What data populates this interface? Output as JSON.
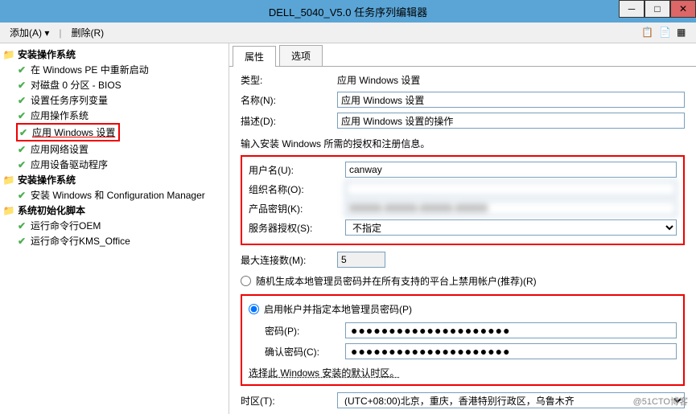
{
  "titlebar": {
    "title": "DELL_5040_V5.0 任务序列编辑器"
  },
  "toolbar": {
    "add": "添加(A) ▾",
    "remove": "删除(R)"
  },
  "tree": {
    "groups": [
      {
        "label": "安装操作系统",
        "items": [
          "在 Windows PE 中重新启动",
          "对磁盘 0 分区 - BIOS",
          "设置任务序列变量",
          "应用操作系统",
          "应用 Windows 设置",
          "应用网络设置",
          "应用设备驱动程序"
        ]
      },
      {
        "label": "安装操作系统",
        "items": [
          "安装 Windows 和 Configuration Manager"
        ]
      },
      {
        "label": "系统初始化脚本",
        "items": [
          "运行命令行OEM",
          "运行命令行KMS_Office"
        ]
      }
    ]
  },
  "tabs": {
    "props": "属性",
    "options": "选项"
  },
  "form": {
    "type_label": "类型:",
    "type_value": "应用 Windows 设置",
    "name_label": "名称(N):",
    "name_value": "应用 Windows 设置",
    "desc_label": "描述(D):",
    "desc_value": "应用 Windows 设置的操作",
    "section1": "输入安装 Windows 所需的授权和注册信息。",
    "user_label": "用户名(U):",
    "user_value": "canway",
    "org_label": "组织名称(O):",
    "org_value": "",
    "key_label": "产品密钥(K):",
    "key_value": "XXXXX-XXXXX-XXXXX-XXXXX",
    "lic_label": "服务器授权(S):",
    "lic_value": "不指定",
    "maxconn_label": "最大连接数(M):",
    "maxconn_value": "5",
    "radio1": "随机生成本地管理员密码并在所有支持的平台上禁用帐户(推荐)(R)",
    "radio2": "启用帐户并指定本地管理员密码(P)",
    "pwd_label": "密码(P):",
    "pwd_confirm_label": "确认密码(C):",
    "pwd_dots": "●●●●●●●●●●●●●●●●●●●●●",
    "tz_section": "选择此 Windows 安装的默认时区。",
    "tz_label": "时区(T):",
    "tz_value": "(UTC+08:00)北京，重庆，香港特别行政区，乌鲁木齐"
  },
  "watermark": "@51CTO博客"
}
